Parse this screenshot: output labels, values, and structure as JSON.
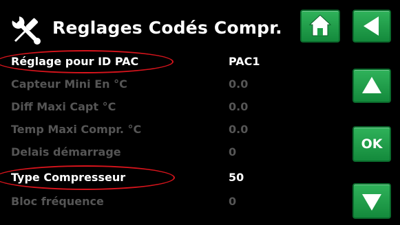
{
  "header": {
    "title": "Reglages Codés Compr.",
    "icon": "tools-icon"
  },
  "buttons": {
    "home_icon": "home-icon",
    "back_icon": "back-arrow-icon",
    "up_icon": "up-arrow-icon",
    "ok_label": "OK",
    "down_icon": "down-arrow-icon"
  },
  "settings": [
    {
      "label": "Réglage pour ID PAC",
      "value": "PAC1",
      "state": "active",
      "highlighted": true
    },
    {
      "label": "Capteur Mini En °C",
      "value": "0.0",
      "state": "inactive",
      "highlighted": false
    },
    {
      "label": "Diff Maxi Capt °C",
      "value": "0.0",
      "state": "inactive",
      "highlighted": false
    },
    {
      "label": "Temp Maxi Compr. °C",
      "value": "0.0",
      "state": "inactive",
      "highlighted": false
    },
    {
      "label": "Delais démarrage",
      "value": "0",
      "state": "inactive",
      "highlighted": false
    },
    {
      "label": "Type Compresseur",
      "value": "50",
      "state": "active",
      "highlighted": true
    },
    {
      "label": "Bloc fréquence",
      "value": "0",
      "state": "inactive",
      "highlighted": false
    }
  ],
  "colors": {
    "background": "#000000",
    "active_text": "#ffffff",
    "inactive_text": "#555555",
    "button_green": "#1e9e48",
    "highlight_ellipse": "#d8141c"
  }
}
